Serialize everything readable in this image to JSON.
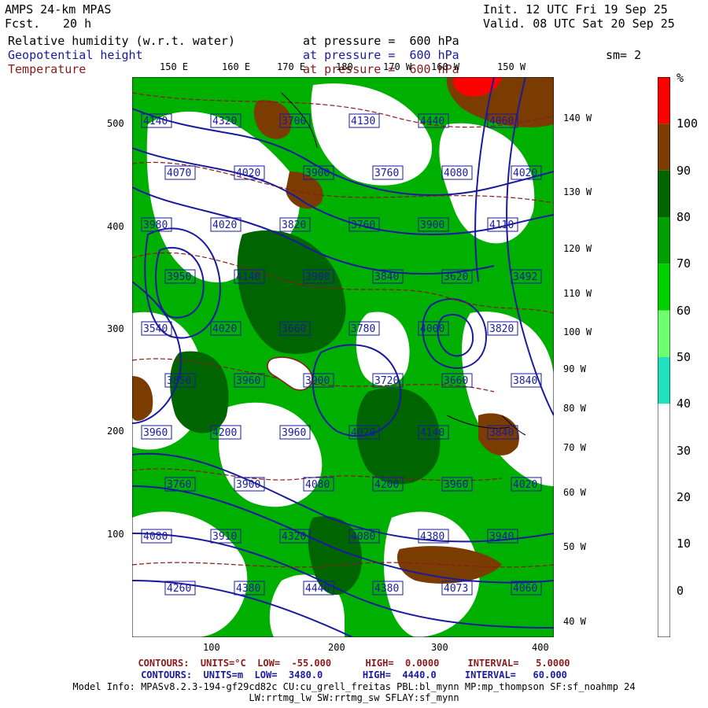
{
  "header": {
    "model": "AMPS 24-km MPAS",
    "fcst_label": "Fcst.",
    "fcst_value": "20 h",
    "init": "Init. 12 UTC Fri 19 Sep 25",
    "valid": "Valid. 08 UTC Sat 20 Sep 25",
    "fields": [
      {
        "name": "Relative humidity (w.r.t. water)",
        "level": "at pressure =  600 hPa"
      },
      {
        "name": "Geopotential height",
        "level": "at pressure =  600 hPa"
      },
      {
        "name": "Temperature",
        "level": "at pressure =  600 hPa"
      }
    ],
    "smooth": "sm= 2"
  },
  "axes": {
    "left_ticks": [
      "500",
      "400",
      "300",
      "200",
      "100"
    ],
    "bottom_ticks": [
      "100",
      "200",
      "300",
      "400"
    ],
    "top_lon": [
      "150 E",
      "160 E",
      "170 E",
      "180",
      "170 W",
      "160 W",
      "150 W"
    ],
    "right_lon": [
      "140 W",
      "130 W",
      "120 W",
      "110 W",
      "100 W",
      "90 W",
      "80 W",
      "70 W",
      "60 W",
      "50 W",
      "40 W"
    ]
  },
  "colorbar": {
    "unit": "%",
    "labels": [
      "100",
      "90",
      "80",
      "70",
      "60",
      "50",
      "40",
      "30",
      "20",
      "10",
      "0"
    ],
    "colors": [
      "#ff0000",
      "#7a3c00",
      "#006400",
      "#00a000",
      "#00d000",
      "#6fff6f",
      "#20e0c0",
      "#ffffff",
      "#ffffff",
      "#ffffff",
      "#ffffff"
    ]
  },
  "contour_labels": [
    "4140",
    "4320",
    "3700",
    "4130",
    "4440",
    "4060",
    "4070",
    "4020",
    "3900",
    "3760",
    "4080",
    "4020",
    "3980",
    "4020",
    "3820",
    "3760",
    "3900",
    "4110",
    "3950",
    "4140",
    "3900",
    "3840",
    "3620",
    "3492",
    "3540",
    "4020",
    "3660",
    "3780",
    "4000",
    "3820",
    "3850",
    "3960",
    "3900",
    "3720",
    "3660",
    "3840",
    "3960",
    "4200",
    "3960",
    "4020",
    "4140",
    "3840",
    "3760",
    "3900",
    "4080",
    "4200",
    "3960",
    "4020",
    "4080",
    "3910",
    "4320",
    "4080",
    "4380",
    "3940",
    "4260",
    "4380",
    "4440",
    "4380",
    "4073",
    "4060"
  ],
  "footer": {
    "temp_line": "CONTOURS:  UNITS=°C  LOW=  -55.000      HIGH=  0.0000     INTERVAL=   5.0000",
    "height_line": "CONTOURS:  UNITS=m  LOW=  3480.0       HIGH=  4440.0     INTERVAL=   60.000",
    "model_info": "Model Info: MPASv8.2.3-194-gf29cd82c CU:cu_grell_freitas PBL:bl_mynn MP:mp_thompson SF:sf_noahmp 24",
    "model_info2": "LW:rrtmg_lw SW:rrtmg_sw SFLAY:sf_mynn"
  }
}
